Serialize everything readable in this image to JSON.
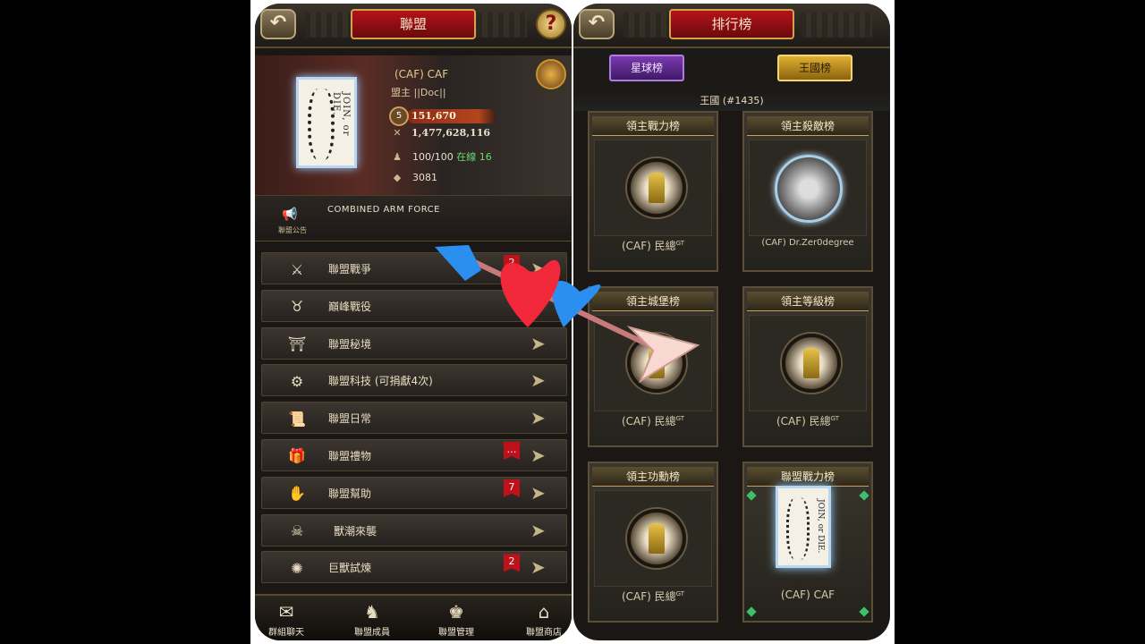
{
  "left_screen": {
    "title": "聯盟",
    "back_label": "↶",
    "help_label": "?",
    "alliance": {
      "name": "(CAF) CAF",
      "leader": "盟主 ||Doc||",
      "level": "5",
      "power": "151,670",
      "kills": "1,477,628,116",
      "members": "100/100",
      "online": "在線 16",
      "gifts": "3081",
      "flag_text": "JOIN, or DIE."
    },
    "announcement": {
      "text": "COMBINED ARM FORCE",
      "label": "聯盟公告"
    },
    "menu": [
      {
        "label": "聯盟戰爭",
        "badge": "2",
        "icon": "crossed-swords-icon",
        "glyph": "⚔"
      },
      {
        "label": "巔峰戰役",
        "badge": "",
        "icon": "bull-skull-icon",
        "glyph": "♉"
      },
      {
        "label": "聯盟秘境",
        "badge": "",
        "icon": "shrine-icon",
        "glyph": "⛩"
      },
      {
        "label": "聯盟科技 (可捐獻4次)",
        "badge": "",
        "icon": "tech-gear-icon",
        "glyph": "⚙"
      },
      {
        "label": "聯盟日常",
        "badge": "",
        "icon": "scroll-icon",
        "glyph": "📜"
      },
      {
        "label": "聯盟禮物",
        "badge": "…",
        "icon": "gift-icon",
        "glyph": "🎁"
      },
      {
        "label": "聯盟幫助",
        "badge": "7",
        "icon": "help-hands-icon",
        "glyph": "✋"
      },
      {
        "label": "獸潮來襲",
        "badge": "",
        "icon": "beast-icon",
        "glyph": "☠"
      },
      {
        "label": "巨獸試煉",
        "badge": "2",
        "icon": "giant-beast-icon",
        "glyph": "✺"
      }
    ],
    "bottom_nav": [
      {
        "label": "群組聊天",
        "icon": "chat-scroll-icon",
        "glyph": "✉"
      },
      {
        "label": "聯盟成員",
        "icon": "members-icon",
        "glyph": "♞"
      },
      {
        "label": "聯盟管理",
        "icon": "manage-icon",
        "glyph": "♚"
      },
      {
        "label": "聯盟商店",
        "icon": "shop-icon",
        "glyph": "⌂"
      }
    ]
  },
  "right_screen": {
    "title": "排行榜",
    "back_label": "↶",
    "tabs": [
      {
        "label": "星球榜",
        "color": "#7a3ab0"
      },
      {
        "label": "王國榜",
        "color": "#e0b030"
      }
    ],
    "kingdom": "王國 (#1435)",
    "cards": [
      {
        "title": "領主戰力榜",
        "name": "(CAF) 民總",
        "suffix": "GT",
        "kind": "statue"
      },
      {
        "title": "領主殺敵榜",
        "name": "(CAF) Dr.Zer0degree",
        "suffix": "",
        "kind": "portrait"
      },
      {
        "title": "領主城堡榜",
        "name": "(CAF) 民總",
        "suffix": "GT",
        "kind": "statue"
      },
      {
        "title": "領主等級榜",
        "name": "(CAF) 民總",
        "suffix": "GT",
        "kind": "statue"
      },
      {
        "title": "領主功勳榜",
        "name": "(CAF) 民總",
        "suffix": "GT",
        "kind": "statue"
      },
      {
        "title": "聯盟戰力榜",
        "name": "(CAF) CAF",
        "suffix": "",
        "kind": "flag"
      }
    ]
  },
  "colors": {
    "badge_red": "#c0101a",
    "gold_accent": "#d4a24a",
    "online_green": "#6bd96b",
    "heart_red": "#f0283a",
    "heart_blue": "#2b8ff0"
  }
}
